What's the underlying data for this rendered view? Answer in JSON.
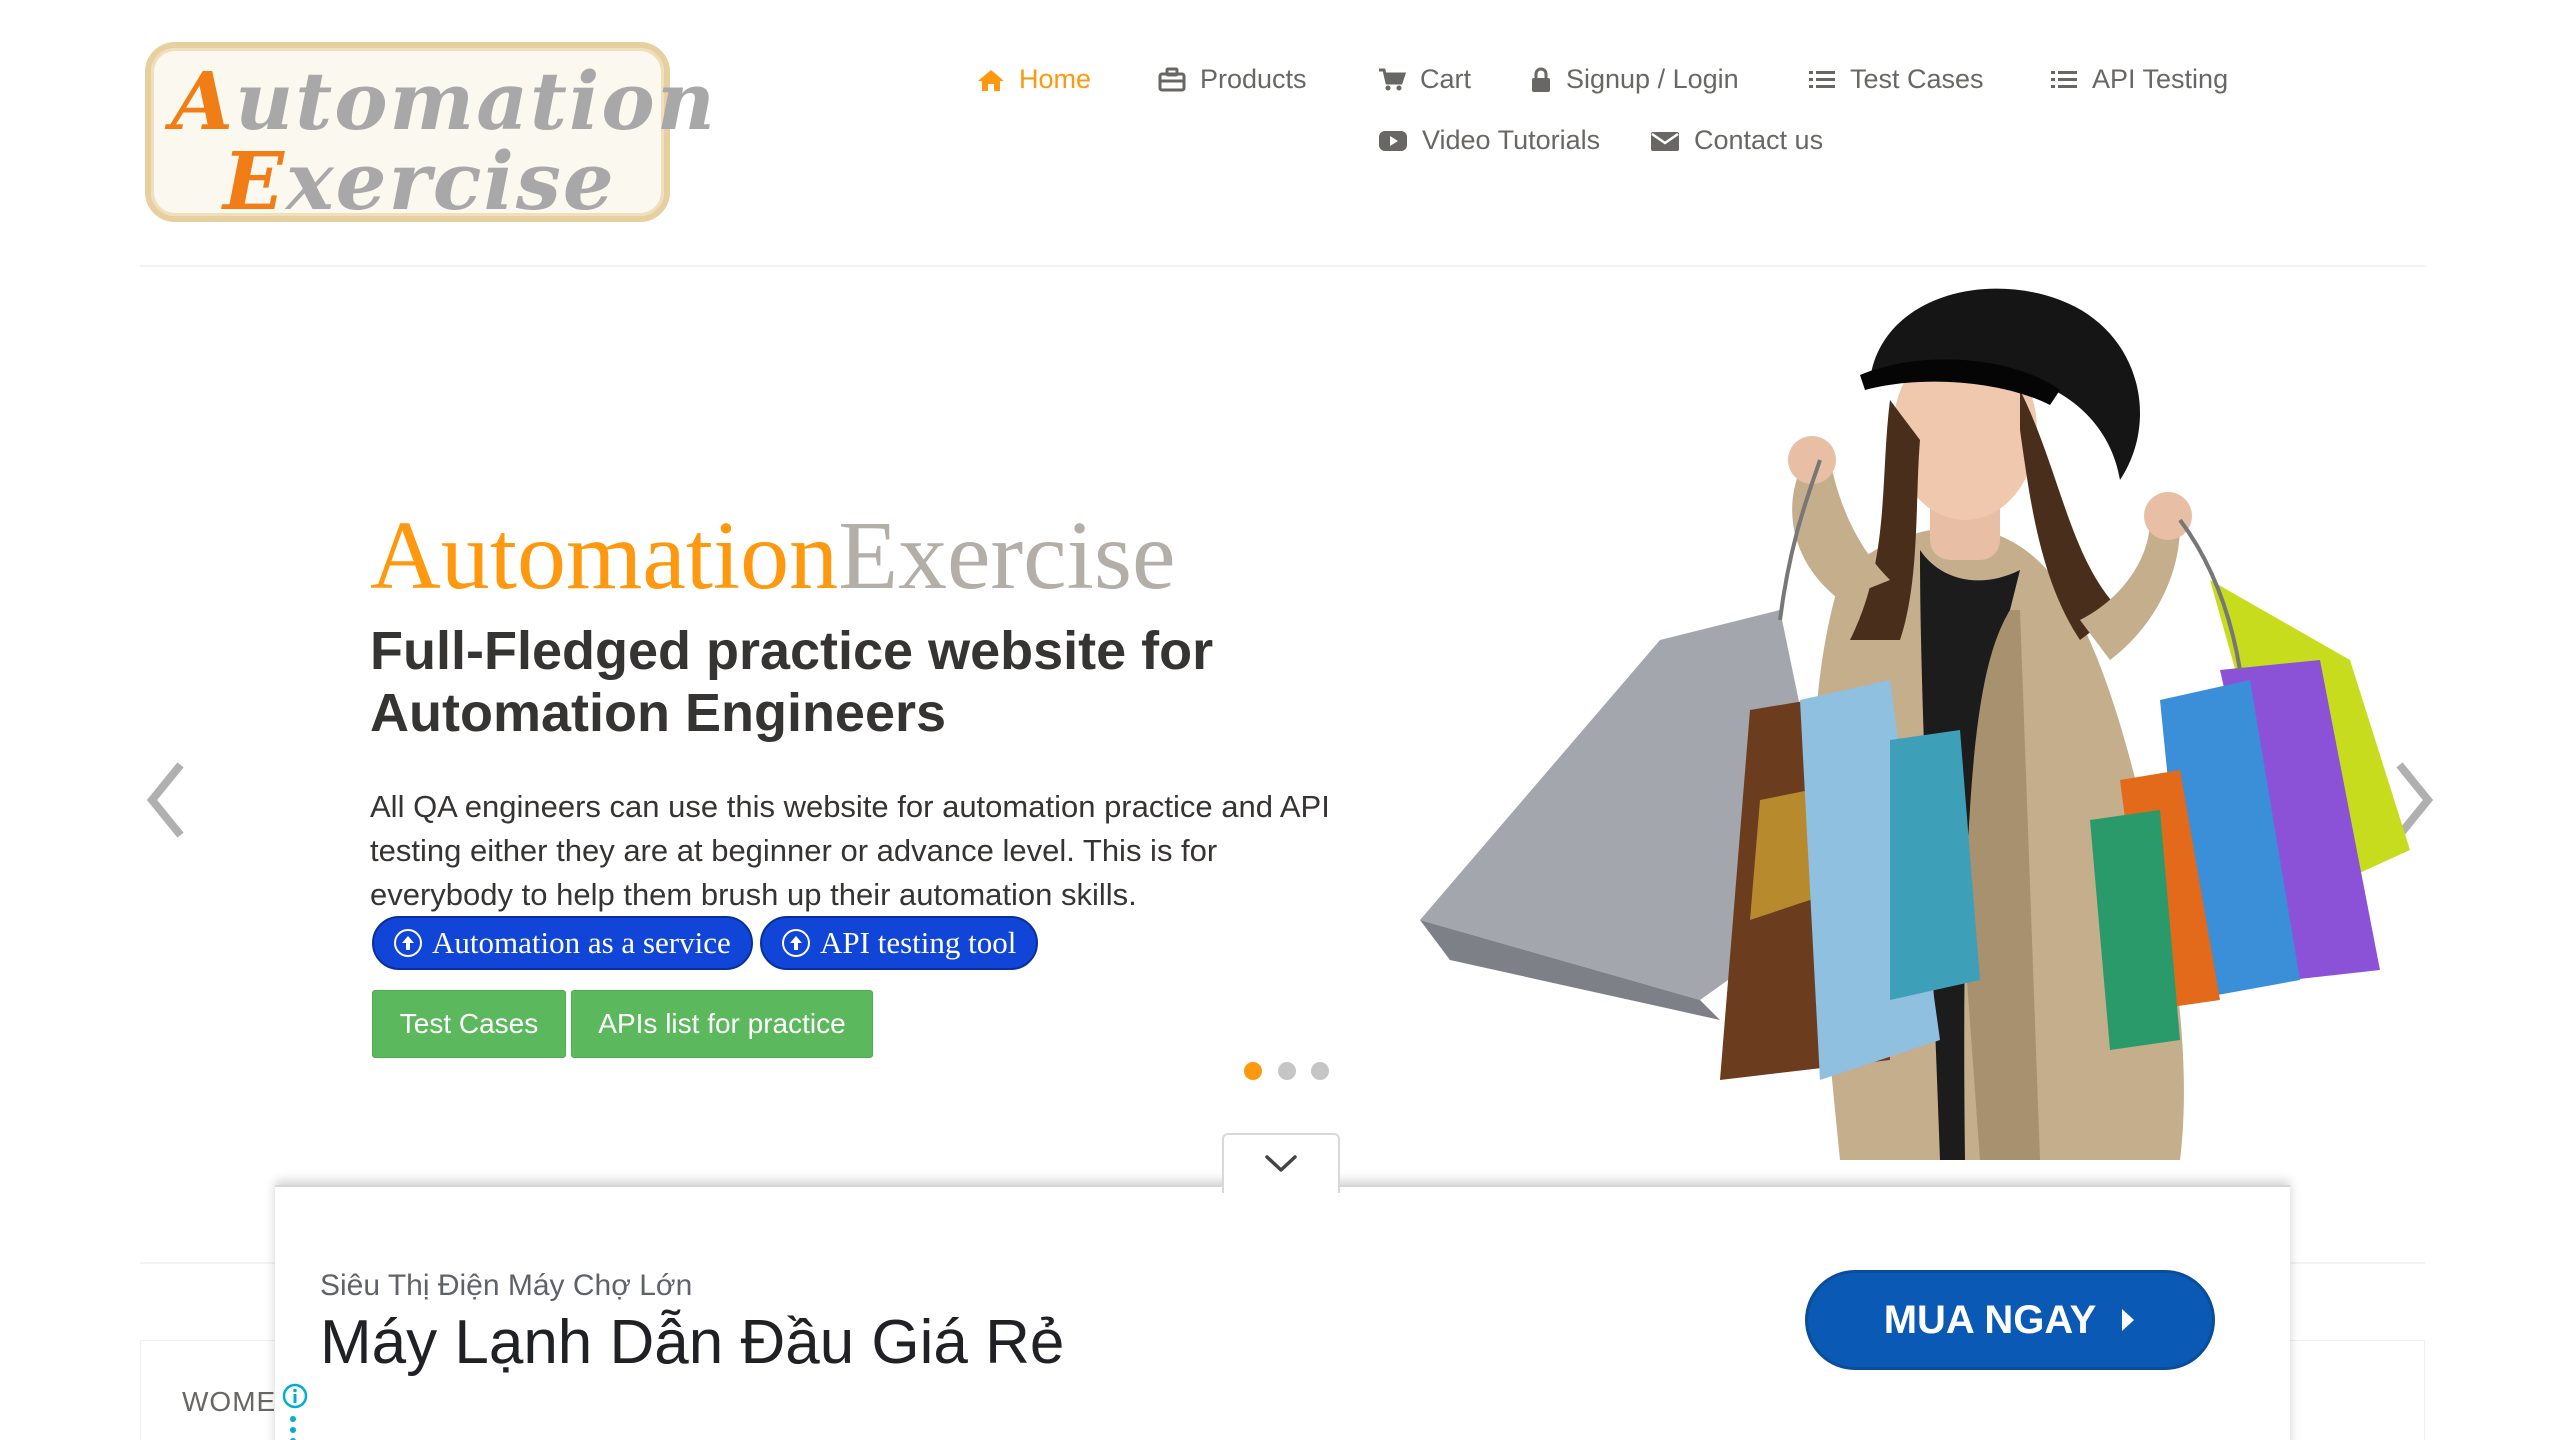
{
  "logo": {
    "line1_cap": "A",
    "line1_rest": "utomation",
    "line2_cap": "E",
    "line2_rest": "xercise"
  },
  "nav": {
    "home": "Home",
    "products": "Products",
    "cart": "Cart",
    "signup_login": "Signup / Login",
    "test_cases": "Test Cases",
    "api_testing": "API Testing",
    "video_tutorials": "Video Tutorials",
    "contact_us": "Contact us"
  },
  "hero": {
    "brand_part1": "Automation",
    "brand_part2": "Exercise",
    "title": "Full-Fledged practice website for Automation Engineers",
    "description": "All QA engineers can use this website for automation practice and API testing either they are at beginner or advance level. This is for everybody to help them brush up their automation skills.",
    "pill_automation": "Automation as a service",
    "pill_api": "API testing tool",
    "btn_test_cases": "Test Cases",
    "btn_apis": "APIs list for practice",
    "active_slide": 1,
    "slide_count": 3
  },
  "category": {
    "partial_label": "WOME"
  },
  "ad": {
    "advertiser": "Siêu Thị Điện Máy Chợ Lớn",
    "headline": "Máy Lạnh Dẫn Đầu Giá Rẻ",
    "cta": "MUA NGAY"
  },
  "colors": {
    "accent": "#fe980f",
    "text": "#696763",
    "green": "#5cb85c",
    "pill_blue": "#1045d8",
    "ad_blue": "#0a59b5"
  }
}
